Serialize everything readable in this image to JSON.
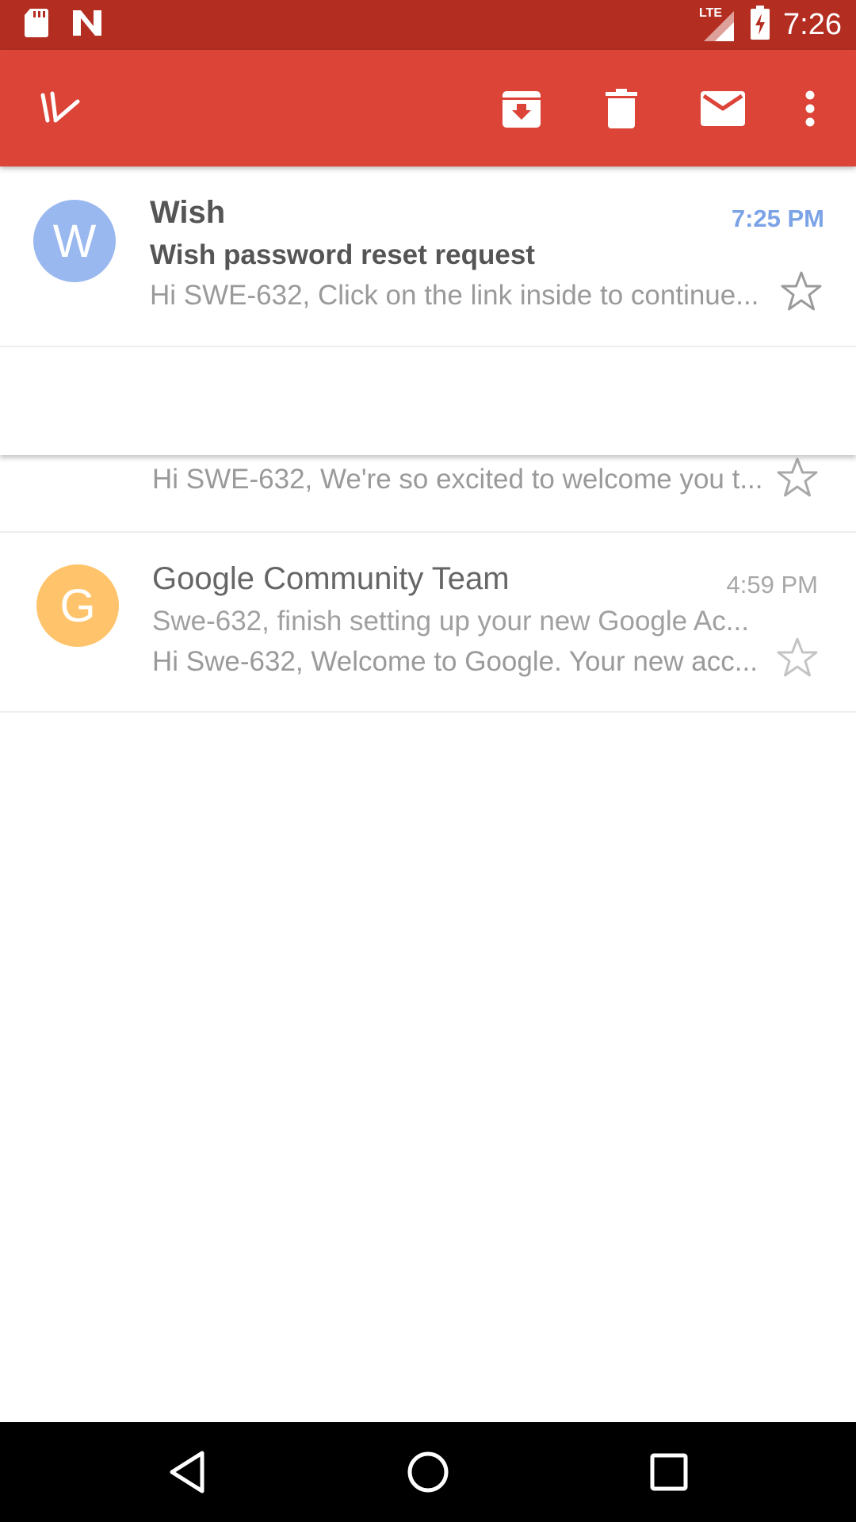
{
  "status_bar": {
    "time": "7:26",
    "network": "LTE",
    "icons": [
      "sd-card-icon",
      "n-logo-icon",
      "signal-icon",
      "battery-charging-icon"
    ]
  },
  "action_bar": {
    "actions": [
      "done-check-icon",
      "archive-icon",
      "delete-icon",
      "mark-unread-icon",
      "overflow-menu-icon"
    ]
  },
  "emails": [
    {
      "avatar_letter": "W",
      "avatar_color": "#9ab8f0",
      "sender": "Wish",
      "subject": "Wish password reset request",
      "snippet": "Hi SWE-632, Click on the link inside to continue...",
      "time": "7:25 PM",
      "time_color": "#7ba3e6",
      "unread": true
    },
    {
      "avatar_color": "#f4a59a",
      "snippet": "Hi SWE-632, We're so excited to welcome you t..."
    },
    {
      "avatar_letter": "G",
      "avatar_color": "#ffc46b",
      "sender": "Google Community Team",
      "subject": "Swe-632, finish setting up your new Google Ac...",
      "snippet": "Hi Swe-632, Welcome to Google. Your new acc...",
      "time": "4:59 PM",
      "time_color": "#a8a8a8",
      "unread": false
    }
  ],
  "nav_bar": {
    "buttons": [
      "back-icon",
      "home-icon",
      "recents-icon"
    ]
  }
}
